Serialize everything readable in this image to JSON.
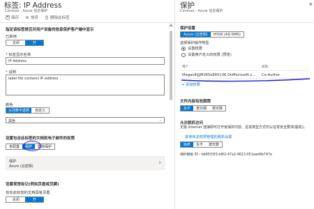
{
  "left": {
    "title": "标签: IP Address",
    "subtitle": "Contoso - Azure 信息保护",
    "toolbar": {
      "save": "保存",
      "discard": "放弃",
      "delete": "删除此标签"
    },
    "sections": {
      "enable_head": "指定该标签是否对用户设备的信息保护客户端中显示",
      "enabled_label": "已启用",
      "display_name_label": "标签显示名称",
      "display_name_value": "IP Address",
      "description_label": "说明",
      "description_value": "label file contains IP address",
      "color_label": "颜色",
      "color_value": "黑色",
      "protection_head": "设置包含此标签的文档和电子邮件的权限",
      "protection_card_line1": "保护",
      "protection_card_line2": "Azure (云密钥)",
      "visual_head": "设置视觉标记(例如页眉或页脚)",
      "header_label": "包含此标签的文档具有页眉"
    },
    "toggle_enabled": [
      "关闭",
      "开"
    ],
    "color_tabs": [
      "从列表中选择",
      "自定义"
    ],
    "protection_tabs": [
      "未配置",
      "保护",
      "删除保护"
    ],
    "header_toggle": [
      "关闭",
      "开"
    ]
  },
  "right": {
    "title": "保护",
    "subtitle": "Contoso - Azure 信息保护",
    "protection_settings_head": "保护设置",
    "key_tabs": [
      "Azure (云密钥)",
      "HYOK (AD RMS)"
    ],
    "permission_type_label": "选择保护操作类型",
    "radio_set_permissions": "设置权限",
    "radio_user_defined": "设置用户定义的权限 (预览)",
    "table_headers": [
      "用户",
      "权限"
    ],
    "table_rows": [
      {
        "user": "Megan8@M365x845136.OnMicrosoft.c...",
        "permission": "Co-Author"
      }
    ],
    "add_permissions": "+ 添加权限",
    "expiry_head": "文件内容有效期限",
    "expiry_options": [
      "永不",
      "按日期",
      "按天数"
    ],
    "offline_head": "允许脱机访问",
    "offline_desc": "无需 Internet 连接即可打开受保护内容。这将类型方式可以在零安全要求(脱机)。",
    "offline_link": "其他有关权限管理的脱机设置",
    "offline_options": [
      "始终",
      "永不",
      "按天数"
    ],
    "template_id": "保护模板 ID - bb6533f3-e8f2-47a2-9623-051aad6b747e"
  },
  "colors": {
    "accent": "#0078d4",
    "annotation": "#1b1bd6"
  }
}
